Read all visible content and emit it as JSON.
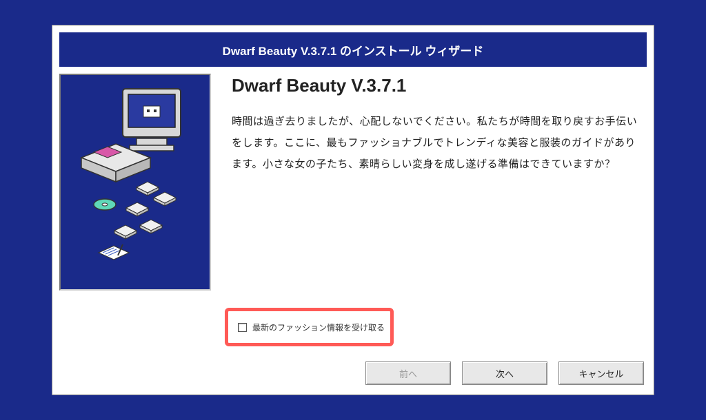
{
  "wizard": {
    "title": "Dwarf Beauty V.3.7.1 のインストール ウィザード",
    "product_name": "Dwarf Beauty V.3.7.1",
    "description": "時間は過ぎ去りましたが、心配しないでください。私たちが時間を取り戻すお手伝いをします。ここに、最もファッショナブルでトレンディな美容と服装のガイドがあります。小さな女の子たち、素晴らしい変身を成し遂げる準備はできていますか？",
    "checkbox": {
      "label": "最新のファッション情報を受け取る",
      "checked": false
    },
    "buttons": {
      "back": "前へ",
      "next": "次へ",
      "cancel": "キャンセル"
    },
    "back_disabled": true
  },
  "colors": {
    "background": "#1a2a8a",
    "highlight": "#ff5a56"
  }
}
